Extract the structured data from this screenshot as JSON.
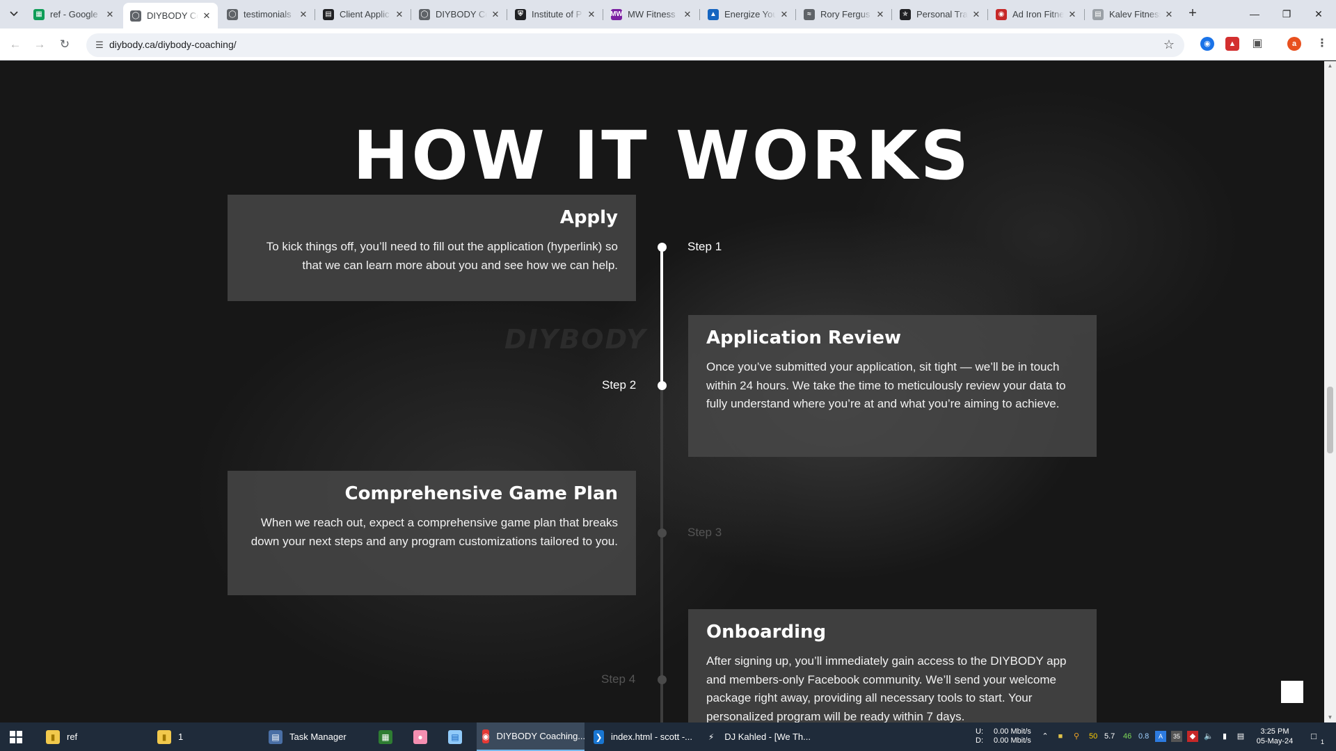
{
  "browser": {
    "tabs": [
      {
        "title": "ref - Google",
        "icon": "sheets-icon",
        "color": "#0f9d58"
      },
      {
        "title": "DIYBODY Co",
        "icon": "globe-icon",
        "color": "#5f6368",
        "active": true
      },
      {
        "title": "testimonials",
        "icon": "globe-icon",
        "color": "#5f6368"
      },
      {
        "title": "Client Applic",
        "icon": "form-icon",
        "color": "#202124"
      },
      {
        "title": "DIYBODY Co",
        "icon": "globe-icon",
        "color": "#5f6368"
      },
      {
        "title": "Institute of P",
        "icon": "shield-icon",
        "color": "#202124"
      },
      {
        "title": "MW Fitness",
        "icon": "mw-icon",
        "color": "#7b1fa2"
      },
      {
        "title": "Energize You",
        "icon": "mountain-icon",
        "color": "#1565c0"
      },
      {
        "title": "Rory Fergus",
        "icon": "wave-icon",
        "color": "#5f6368"
      },
      {
        "title": "Personal Tra",
        "icon": "runner-icon",
        "color": "#202124"
      },
      {
        "title": "Ad Iron Fitne",
        "icon": "target-icon",
        "color": "#c62828"
      },
      {
        "title": "Kalev Fitness",
        "icon": "page-icon",
        "color": "#9aa0a6"
      }
    ],
    "url": "diybody.ca/diybody-coaching/",
    "profile_initial": "a"
  },
  "page": {
    "section_title": "HOW IT WORKS",
    "watermark": "DIYBODY",
    "steps": [
      {
        "label": "Step 1",
        "title": "Apply",
        "body": "To kick things off, you’ll need to fill out the application (hyperlink) so that we can learn more about you and see how we can help.",
        "active": true
      },
      {
        "label": "Step 2",
        "title": "Application Review",
        "body": "Once you’ve submitted your application, sit tight — we’ll be in touch within 24 hours. We take the time to meticulously review your data to fully understand where you’re at and what you’re aiming to achieve.",
        "active": true
      },
      {
        "label": "Step 3",
        "title": "Comprehensive Game Plan",
        "body": "When we reach out, expect a comprehensive game plan that breaks down your next steps and any program customizations tailored to you.",
        "active": false
      },
      {
        "label": "Step 4",
        "title": "Onboarding",
        "body": "After signing up, you’ll immediately gain access to the DIYBODY app and members-only Facebook community. We’ll send your welcome package right away, providing all necessary tools to start. Your personalized program will be ready within 7 days.",
        "active": false
      }
    ]
  },
  "taskbar": {
    "items": [
      {
        "label": "ref",
        "icon": "folder-icon"
      },
      {
        "label": "1",
        "icon": "folder-icon"
      },
      {
        "label": "Task Manager",
        "icon": "task-manager-icon"
      },
      {
        "label": "",
        "icon": "spreadsheet-icon"
      },
      {
        "label": "",
        "icon": "pig-icon"
      },
      {
        "label": "",
        "icon": "notepad-icon"
      },
      {
        "label": "DIYBODY Coaching...",
        "icon": "chrome-icon",
        "active": true
      },
      {
        "label": "index.html - scott -...",
        "icon": "vscode-icon"
      },
      {
        "label": "DJ Kahled - [We Th...",
        "icon": "winamp-icon"
      }
    ],
    "net_u_label": "U:",
    "net_d_label": "D:",
    "net_up": "0.00 Mbit/s",
    "net_down": "0.00 Mbit/s",
    "tray_nums": [
      "50",
      "5.7",
      "46",
      "0.8"
    ],
    "time": "3:25 PM",
    "date": "05-May-24",
    "notif_count": "1"
  },
  "colors": {
    "active_step": "#ffffff",
    "inactive_step": "#555555",
    "card_bg": "#484848",
    "page_bg": "#171717"
  }
}
